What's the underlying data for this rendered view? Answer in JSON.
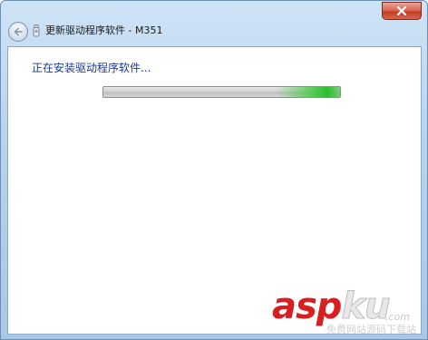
{
  "window": {
    "title": "更新驱动程序软件 - M351",
    "close_icon": "close-icon",
    "back_icon": "back-arrow-icon",
    "device_icon": "usb-device-icon"
  },
  "main": {
    "heading": "正在安装驱动程序软件...",
    "progress": {
      "state": "indeterminate",
      "fill_color": "#3ac83a"
    }
  },
  "watermark": {
    "brand_red": "asp",
    "brand_grey": "ku",
    "domain_suffix": ".com",
    "tagline": "免费网站源码下载站",
    "accent_color": "#d81e1e"
  }
}
